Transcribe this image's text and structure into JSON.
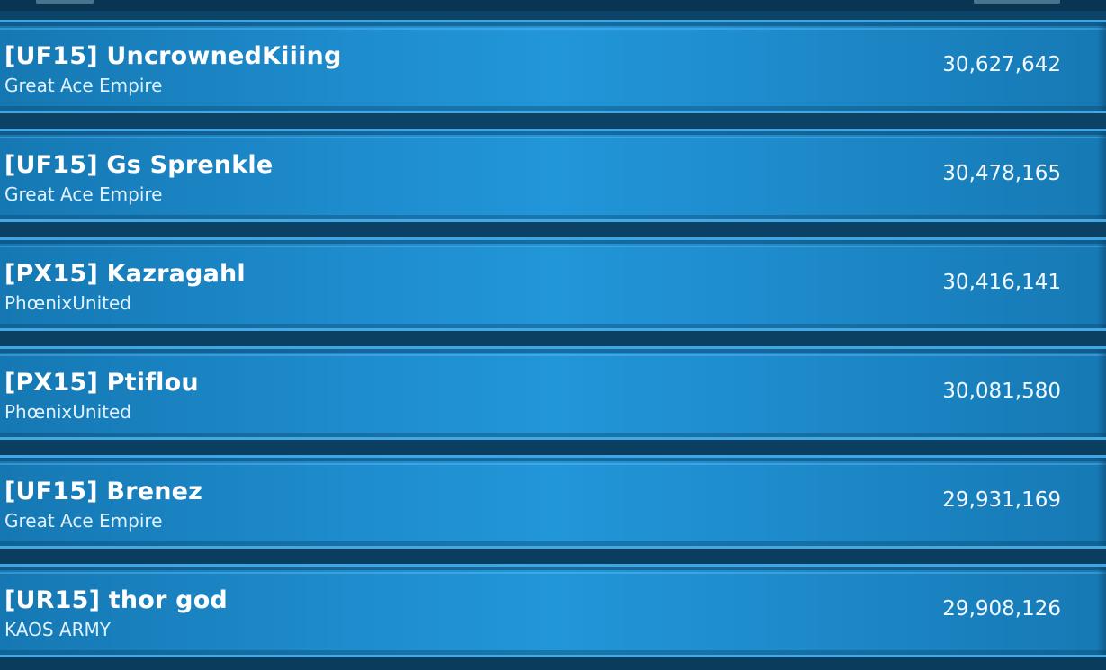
{
  "leaderboard": {
    "rows": [
      {
        "player": "[UF15] UncrownedKiiing",
        "alliance": "Great Ace Empire",
        "score": "30,627,642"
      },
      {
        "player": "[UF15] Gs Sprenkle",
        "alliance": "Great Ace Empire",
        "score": "30,478,165"
      },
      {
        "player": "[PX15] Kazragahl",
        "alliance": "PhœnixUnited",
        "score": "30,416,141"
      },
      {
        "player": "[PX15] Ptiflou",
        "alliance": "PhœnixUnited",
        "score": "30,081,580"
      },
      {
        "player": "[UF15] Brenez",
        "alliance": "Great Ace Empire",
        "score": "29,931,169"
      },
      {
        "player": "[UR15] thor god",
        "alliance": "KAOS ARMY",
        "score": "29,908,126"
      }
    ]
  },
  "colors": {
    "row_base": "#1f8ed0",
    "row_border": "#3ea6e2",
    "background": "#0b3a5a",
    "text_primary": "#ffffff"
  }
}
